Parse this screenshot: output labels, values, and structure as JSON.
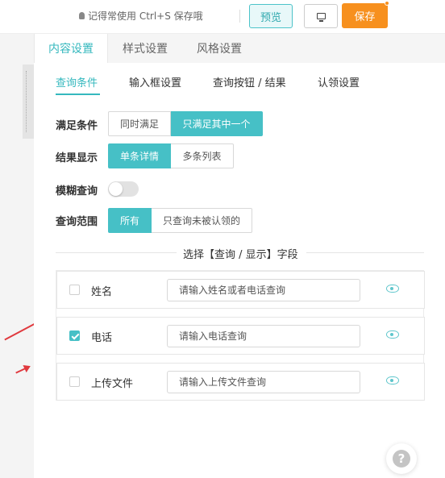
{
  "topbar": {
    "tip": "记得常使用 Ctrl+S 保存哦",
    "preview_label": "预览",
    "save_label": "保存"
  },
  "tabs_main": [
    {
      "label": "内容设置",
      "active": true
    },
    {
      "label": "样式设置",
      "active": false
    },
    {
      "label": "风格设置",
      "active": false
    }
  ],
  "tabs_sub": [
    {
      "label": "查询条件",
      "active": true
    },
    {
      "label": "输入框设置",
      "active": false
    },
    {
      "label": "查询按钮 / 结果",
      "active": false
    },
    {
      "label": "认领设置",
      "active": false
    }
  ],
  "settings": {
    "condition": {
      "label": "满足条件",
      "options": [
        "同时满足",
        "只满足其中一个"
      ],
      "selected": 1
    },
    "display": {
      "label": "结果显示",
      "options": [
        "单条详情",
        "多条列表"
      ],
      "selected": 0
    },
    "fuzzy": {
      "label": "模糊查询",
      "enabled": false
    },
    "scope": {
      "label": "查询范围",
      "options": [
        "所有",
        "只查询未被认领的"
      ],
      "selected": 0
    }
  },
  "fields_title": "选择【查询 / 显示】字段",
  "fields": [
    {
      "name": "姓名",
      "checked": false,
      "placeholder": "请输入姓名或者电话查询"
    },
    {
      "name": "电话",
      "checked": true,
      "placeholder": "请输入电话查询"
    },
    {
      "name": "上传文件",
      "checked": false,
      "placeholder": "请输入上传文件查询"
    }
  ],
  "help_label": "?",
  "colors": {
    "accent": "#46c0c6",
    "save": "#f7901e",
    "annotation_arrow": "#e0393e"
  }
}
